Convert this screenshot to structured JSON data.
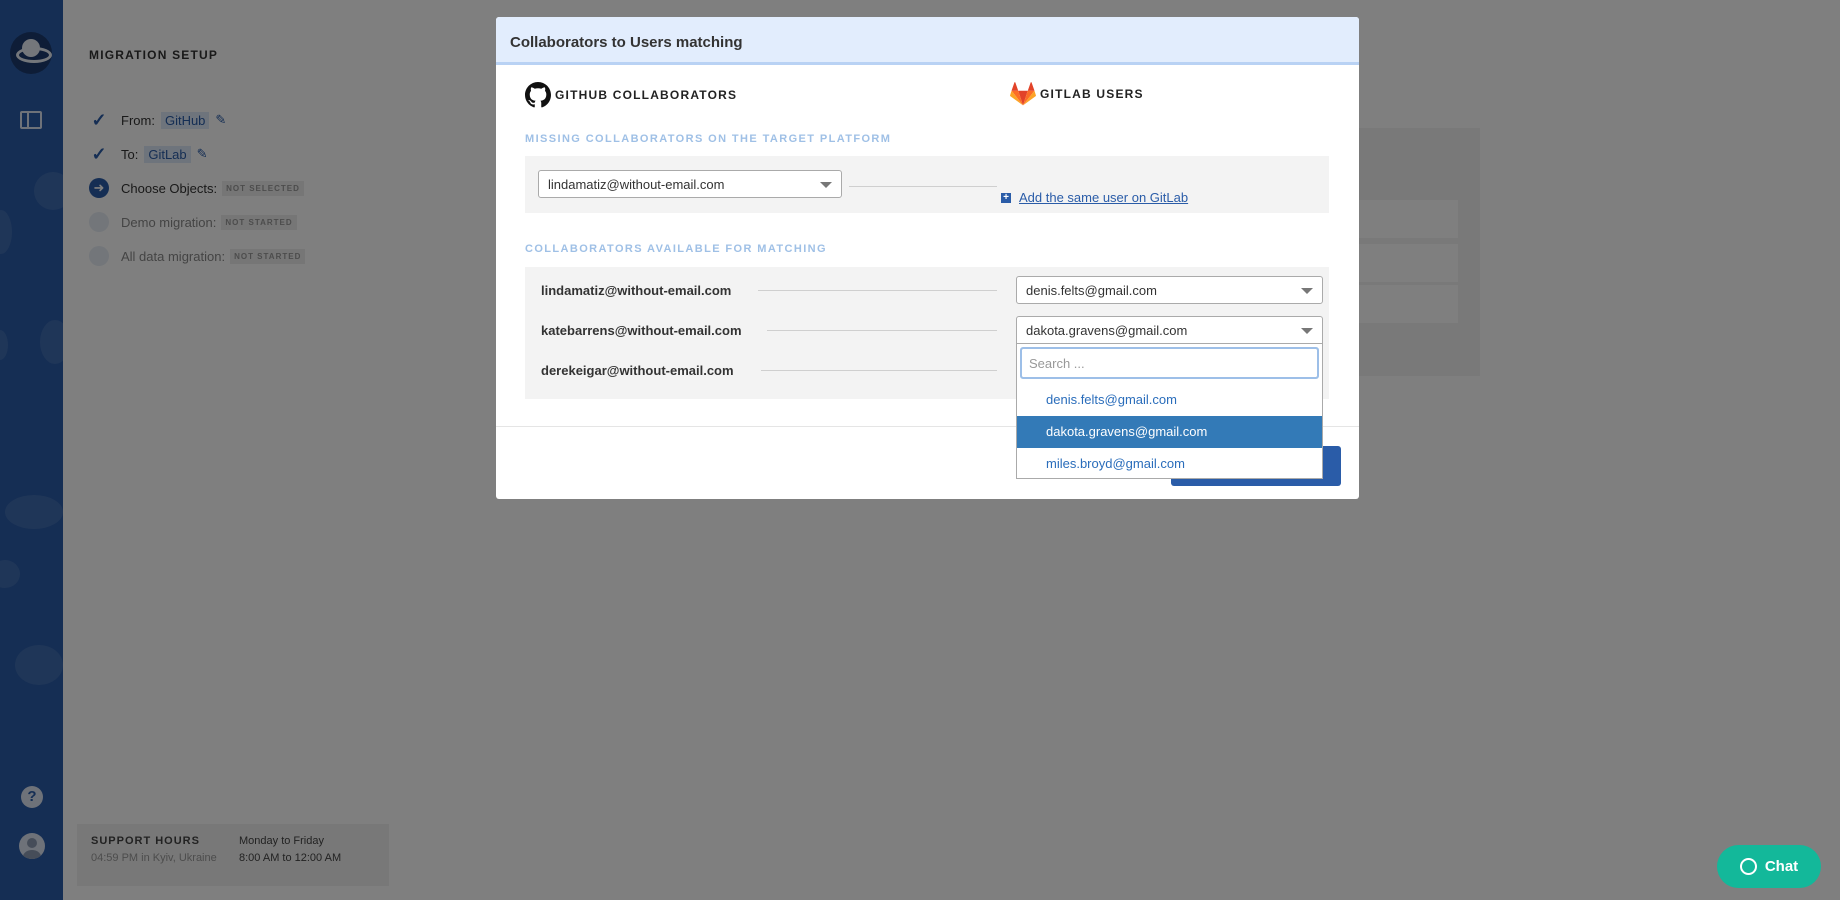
{
  "sidebar": {
    "title": "MIGRATION SETUP",
    "steps": [
      {
        "label": "From:",
        "value": "GitHub",
        "status": "done"
      },
      {
        "label": "To:",
        "value": "GitLab",
        "status": "done"
      },
      {
        "label": "Choose Objects:",
        "badge": "NOT SELECTED",
        "status": "current"
      },
      {
        "label": "Demo migration:",
        "badge": "NOT STARTED",
        "status": "pending"
      },
      {
        "label": "All data migration:",
        "badge": "NOT STARTED",
        "status": "pending"
      }
    ],
    "support": {
      "title": "SUPPORT HOURS",
      "local_time": "04:59 PM in Kyiv, Ukraine",
      "days": "Monday to Friday",
      "hours": "8:00 AM to 12:00 AM"
    }
  },
  "modal": {
    "title": "Collaborators to Users matching",
    "left_column": "GITHUB COLLABORATORS",
    "right_column": "GITLAB USERS",
    "missing_section": {
      "label": "MISSING COLLABORATORS ON THE TARGET PLATFORM",
      "selected": "lindamatiz@without-email.com",
      "add_link": "Add the same user on GitLab"
    },
    "matching_section": {
      "label": "COLLABORATORS AVAILABLE FOR MATCHING",
      "rows": [
        {
          "collaborator": "lindamatiz@without-email.com",
          "user": "denis.felts@gmail.com"
        },
        {
          "collaborator": "katebarrens@without-email.com",
          "user": "dakota.gravens@gmail.com"
        },
        {
          "collaborator": "derekeigar@without-email.com",
          "user": ""
        }
      ]
    }
  },
  "dropdown": {
    "search_placeholder": "Search ...",
    "options": [
      "denis.felts@gmail.com",
      "dakota.gravens@gmail.com",
      "miles.broyd@gmail.com"
    ],
    "selected_index": 1
  },
  "chat": {
    "label": "Chat"
  },
  "colors": {
    "accent": "#2a5ca8",
    "selected_option": "#337ab7",
    "chat": "#13b89a"
  }
}
